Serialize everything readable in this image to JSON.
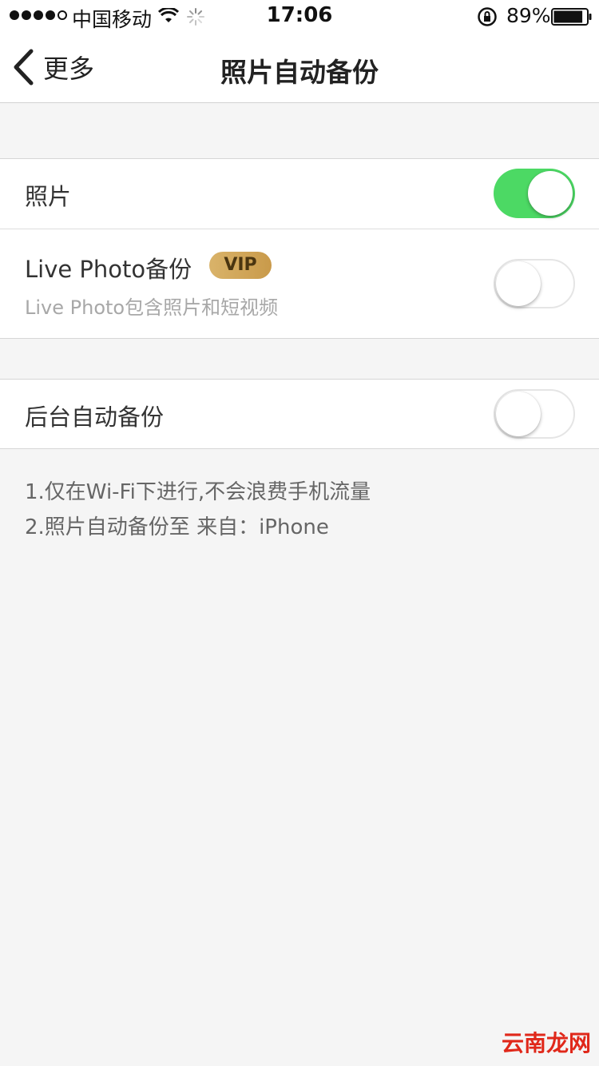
{
  "status_bar": {
    "carrier": "中国移动",
    "time": "17:06",
    "battery_percent": "89%",
    "battery_level": 0.89,
    "signal_bars": 4
  },
  "nav": {
    "back_label": "更多",
    "title": "照片自动备份"
  },
  "settings": {
    "photos": {
      "label": "照片",
      "enabled": true
    },
    "live_photo": {
      "label": "Live Photo备份",
      "badge": "VIP",
      "subtitle": "Live Photo包含照片和短视频",
      "enabled": false
    },
    "background": {
      "label": "后台自动备份",
      "enabled": false
    }
  },
  "notes": [
    "1.仅在Wi-Fi下进行,不会浪费手机流量",
    "2.照片自动备份至 来自：iPhone"
  ],
  "watermark": "云南龙网",
  "colors": {
    "toggle_on": "#4cd964",
    "vip_badge": "#d9b36a",
    "background": "#f5f5f5"
  }
}
